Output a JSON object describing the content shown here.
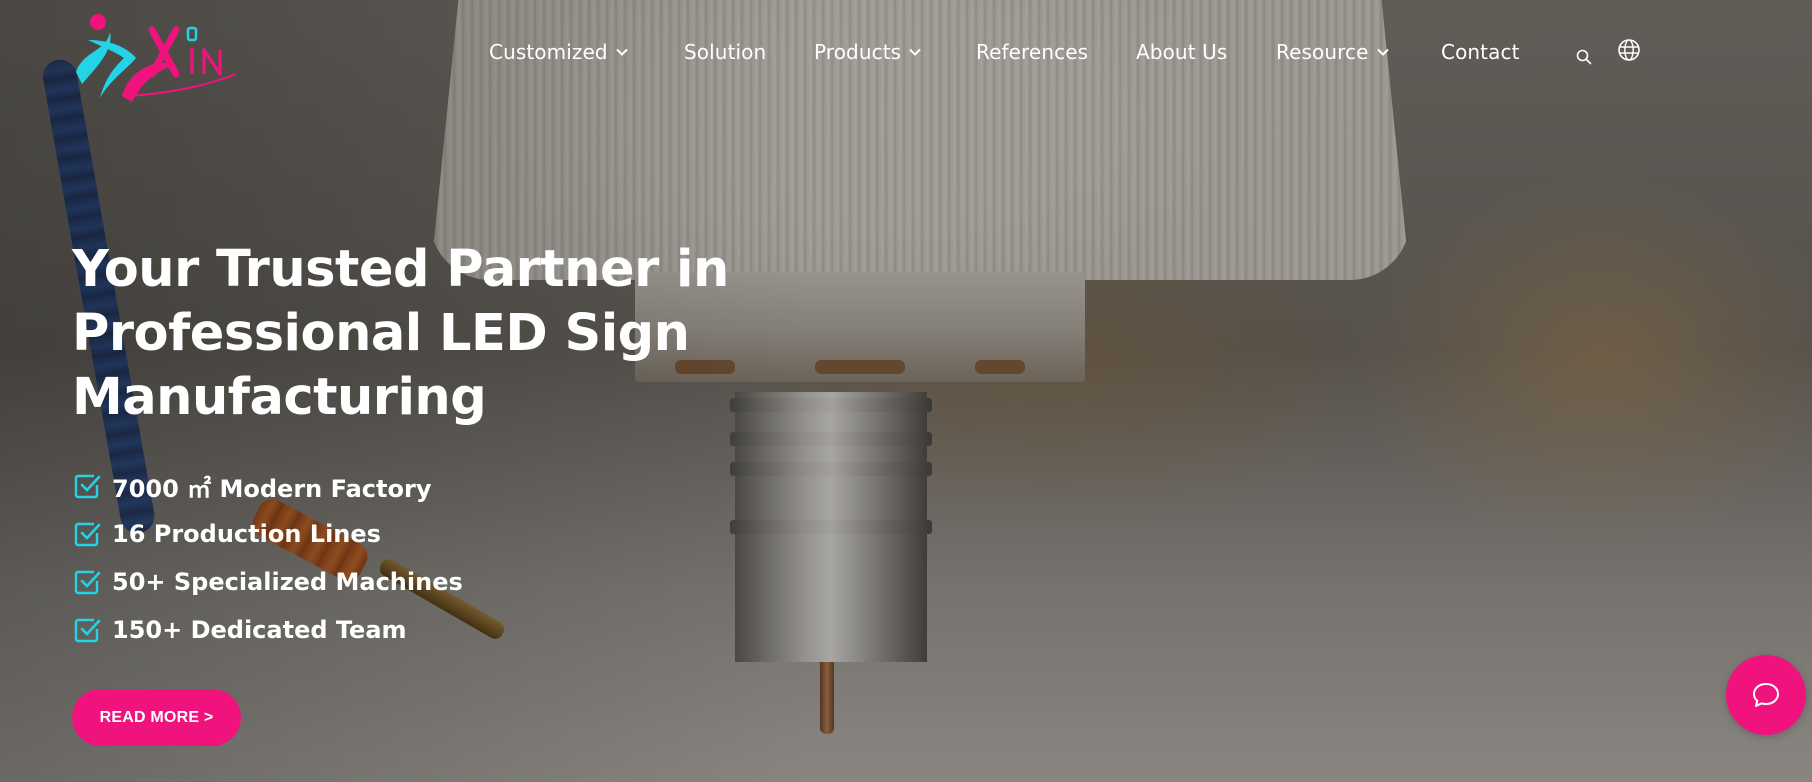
{
  "brand": {
    "logo_letters": "Xin",
    "colors": {
      "cyan": "#22d4e6",
      "magenta": "#f0137d"
    }
  },
  "nav": {
    "items": [
      {
        "label": "Customized",
        "has_dropdown": true
      },
      {
        "label": "Solution",
        "has_dropdown": false
      },
      {
        "label": "Products",
        "has_dropdown": true
      },
      {
        "label": "References",
        "has_dropdown": false
      },
      {
        "label": "About Us",
        "has_dropdown": false
      },
      {
        "label": "Resource",
        "has_dropdown": true
      },
      {
        "label": "Contact",
        "has_dropdown": false
      }
    ],
    "search_icon": "search-icon",
    "language_icon": "globe-icon"
  },
  "hero": {
    "headline": "Your Trusted Partner in Professional LED Sign Manufacturing",
    "features": [
      "7000 ㎡ Modern Factory",
      "16 Production Lines",
      "50+ Specialized Machines",
      "150+ Dedicated Team"
    ],
    "feature_icon": "checkbox-icon",
    "cta_label": "READ MORE >"
  },
  "chat": {
    "icon": "chat-bubble-icon"
  }
}
